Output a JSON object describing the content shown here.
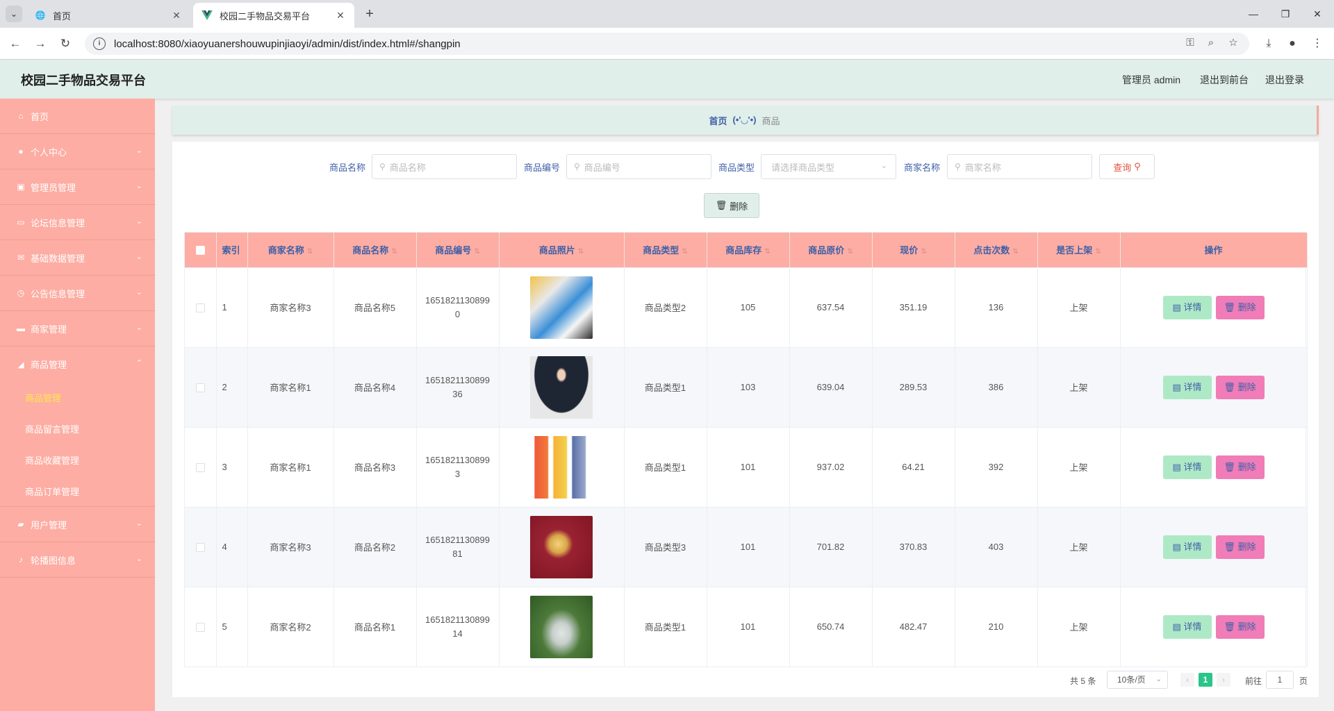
{
  "browser": {
    "tabs": [
      {
        "title": "首页",
        "active": false
      },
      {
        "title": "校园二手物品交易平台",
        "active": true
      }
    ],
    "url": "localhost:8080/xiaoyuanershouwupinjiaoyi/admin/dist/index.html#/shangpin"
  },
  "header": {
    "title": "校园二手物品交易平台",
    "user": "管理员 admin",
    "to_front": "退出到前台",
    "logout": "退出登录"
  },
  "sidebar": {
    "items": [
      {
        "label": "首页",
        "icon": "home-icon"
      },
      {
        "label": "个人中心",
        "icon": "user-icon"
      },
      {
        "label": "管理员管理",
        "icon": "edit-icon"
      },
      {
        "label": "论坛信息管理",
        "icon": "card-icon"
      },
      {
        "label": "基础数据管理",
        "icon": "mail-icon"
      },
      {
        "label": "公告信息管理",
        "icon": "clock-icon"
      },
      {
        "label": "商家管理",
        "icon": "shop-icon"
      },
      {
        "label": "商品管理",
        "icon": "goods-icon"
      },
      {
        "label": "用户管理",
        "icon": "briefcase-icon"
      },
      {
        "label": "轮播图信息",
        "icon": "mic-icon"
      }
    ],
    "submenu": [
      "商品管理",
      "商品留言管理",
      "商品收藏管理",
      "商品订单管理"
    ]
  },
  "breadcrumb": {
    "home": "首页",
    "separator": "(•'◡'•)",
    "current": "商品"
  },
  "search": {
    "name_label": "商品名称",
    "name_placeholder": "商品名称",
    "code_label": "商品编号",
    "code_placeholder": "商品编号",
    "type_label": "商品类型",
    "type_placeholder": "请选择商品类型",
    "shop_label": "商家名称",
    "shop_placeholder": "商家名称",
    "query_button": "查询"
  },
  "actions": {
    "batch_delete": "删除"
  },
  "table": {
    "columns": [
      "索引",
      "商家名称",
      "商品名称",
      "商品编号",
      "商品照片",
      "商品类型",
      "商品库存",
      "商品原价",
      "现价",
      "点击次数",
      "是否上架",
      "操作"
    ],
    "rows": [
      {
        "index": "1",
        "shop": "商家名称3",
        "name": "商品名称5",
        "code": "16518211308990",
        "type": "商品类型2",
        "stock": "105",
        "orig": "637.54",
        "price": "351.19",
        "clicks": "136",
        "status": "上架"
      },
      {
        "index": "2",
        "shop": "商家名称1",
        "name": "商品名称4",
        "code": "165182113089936",
        "type": "商品类型1",
        "stock": "103",
        "orig": "639.04",
        "price": "289.53",
        "clicks": "386",
        "status": "上架"
      },
      {
        "index": "3",
        "shop": "商家名称1",
        "name": "商品名称3",
        "code": "16518211308993",
        "type": "商品类型1",
        "stock": "101",
        "orig": "937.02",
        "price": "64.21",
        "clicks": "392",
        "status": "上架"
      },
      {
        "index": "4",
        "shop": "商家名称3",
        "name": "商品名称2",
        "code": "165182113089981",
        "type": "商品类型3",
        "stock": "101",
        "orig": "701.82",
        "price": "370.83",
        "clicks": "403",
        "status": "上架"
      },
      {
        "index": "5",
        "shop": "商家名称2",
        "name": "商品名称1",
        "code": "165182113089914",
        "type": "商品类型1",
        "stock": "101",
        "orig": "650.74",
        "price": "482.47",
        "clicks": "210",
        "status": "上架"
      }
    ],
    "detail_label": "详情",
    "delete_label": "删除"
  },
  "pagination": {
    "total": "共 5 条",
    "page_size": "10条/页",
    "current": "1",
    "goto": "前往",
    "goto_value": "1",
    "page_unit": "页"
  }
}
